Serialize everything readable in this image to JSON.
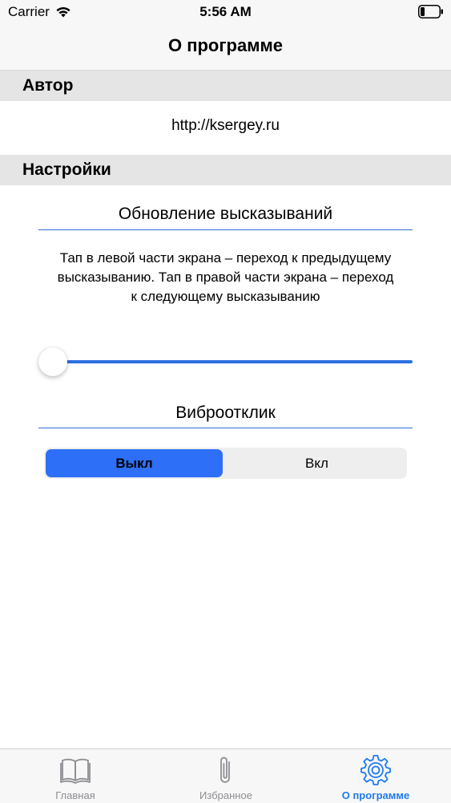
{
  "status_bar": {
    "carrier": "Carrier",
    "time": "5:56 AM",
    "icons": [
      "wifi-icon",
      "battery-icon"
    ]
  },
  "nav": {
    "title": "О программе"
  },
  "sections": {
    "author": {
      "header": "Автор",
      "link": "http://ksergey.ru"
    },
    "settings": {
      "header": "Настройки",
      "quote_update": {
        "title": "Обновление высказываний",
        "description": "Тап в левой части экрана – переход к предыдущему высказыванию. Тап в правой части экрана – переход к следующему высказыванию",
        "slider_value": 0
      },
      "haptics": {
        "title": "Виброотклик",
        "options": [
          "Выкл",
          "Вкл"
        ],
        "selected": "Выкл"
      }
    }
  },
  "tab_bar": {
    "items": [
      {
        "label": "Главная",
        "icon": "book-icon",
        "active": false
      },
      {
        "label": "Избранное",
        "icon": "paperclip-icon",
        "active": false
      },
      {
        "label": "О программе",
        "icon": "gear-icon",
        "active": true
      }
    ]
  },
  "colors": {
    "accent": "#2d6ff7",
    "tab_active": "#1f7af0",
    "tab_inactive": "#8e8e93",
    "section_bg": "#e5e5e5"
  }
}
